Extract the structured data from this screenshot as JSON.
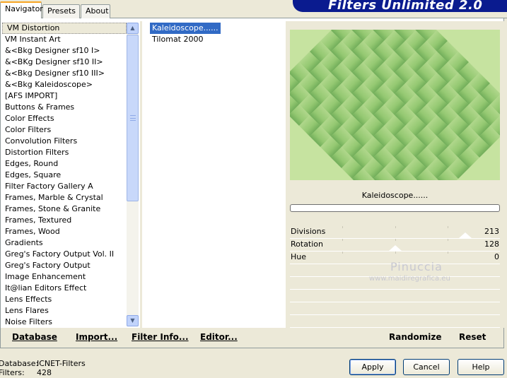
{
  "tabs": [
    "Navigator",
    "Presets",
    "About"
  ],
  "banner_title": "Filters Unlimited 2.0",
  "categories": [
    "VM Distortion",
    "VM Instant Art",
    "&<Bkg Designer sf10 I>",
    "&<BKg Designer sf10 II>",
    "&<Bkg Designer sf10 III>",
    "&<Bkg Kaleidoscope>",
    "[AFS IMPORT]",
    "Buttons & Frames",
    "Color Effects",
    "Color Filters",
    "Convolution Filters",
    "Distortion Filters",
    "Edges, Round",
    "Edges, Square",
    "Filter Factory Gallery A",
    "Frames, Marble & Crystal",
    "Frames, Stone & Granite",
    "Frames, Textured",
    "Frames, Wood",
    "Gradients",
    "Greg's Factory Output Vol. II",
    "Greg's Factory Output",
    "Image Enhancement",
    "It@lian Editors Effect",
    "Lens Effects",
    "Lens Flares",
    "Noise Filters"
  ],
  "selected_category_index": 0,
  "filters": [
    "Kaleidoscope......",
    "Tilomat 2000"
  ],
  "selected_filter_index": 0,
  "preview": {
    "filter_name": "Kaleidoscope......",
    "colors": {
      "light": "#c6e3a0",
      "mid": "#8cc46a",
      "dark": "#2f7d2a"
    }
  },
  "params": [
    {
      "name": "Divisions",
      "value": "213",
      "fraction": 0.835
    },
    {
      "name": "Rotation",
      "value": "128",
      "fraction": 0.502
    },
    {
      "name": "Hue",
      "value": "0",
      "fraction": null
    }
  ],
  "watermark": {
    "name": "Pinuccia",
    "url": "www.maidiregrafica.eu"
  },
  "bottom_buttons": {
    "database": "Database",
    "import": "Import...",
    "filter_info": "Filter Info...",
    "editor": "Editor...",
    "randomize": "Randomize",
    "reset": "Reset"
  },
  "footer": {
    "database_label": "Database:",
    "database_value": "ICNET-Filters",
    "filters_label": "Filters:",
    "filters_value": "428"
  },
  "dialog_buttons": {
    "apply": "Apply",
    "cancel": "Cancel",
    "help": "Help"
  }
}
